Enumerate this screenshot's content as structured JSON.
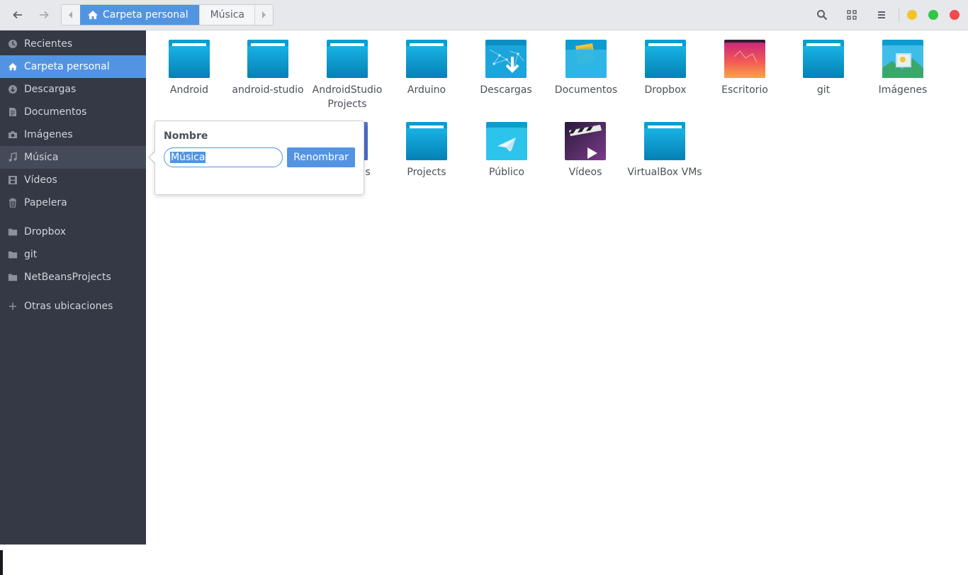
{
  "header": {
    "back_icon": "arrow-left-icon",
    "forward_icon": "arrow-right-icon",
    "path": {
      "current": "Carpeta personal",
      "next": "Música"
    },
    "actions": [
      "search-icon",
      "view-grid-icon",
      "menu-icon"
    ],
    "window_controls": {
      "minimize_color": "#f5c22a",
      "maximize_color": "#33c748",
      "close_color": "#f24a4e"
    }
  },
  "sidebar": {
    "items": [
      {
        "label": "Recientes",
        "icon": "clock-icon"
      },
      {
        "label": "Carpeta personal",
        "icon": "home-icon",
        "selected": true
      },
      {
        "label": "Descargas",
        "icon": "download-icon"
      },
      {
        "label": "Documentos",
        "icon": "document-icon"
      },
      {
        "label": "Imágenes",
        "icon": "camera-icon"
      },
      {
        "label": "Música",
        "icon": "music-icon",
        "hovered": true
      },
      {
        "label": "Vídeos",
        "icon": "film-icon"
      },
      {
        "label": "Papelera",
        "icon": "trash-icon"
      },
      {
        "label": "Dropbox",
        "icon": "folder-icon"
      },
      {
        "label": "git",
        "icon": "folder-icon"
      },
      {
        "label": "NetBeansProjects",
        "icon": "folder-icon"
      },
      {
        "label": "Otras ubicaciones",
        "icon": "plus-icon"
      }
    ]
  },
  "files": [
    {
      "name": "Android"
    },
    {
      "name": "android-studio"
    },
    {
      "name": "AndroidStudio Projects"
    },
    {
      "name": "Arduino"
    },
    {
      "name": "Descargas"
    },
    {
      "name": "Documentos"
    },
    {
      "name": "Dropbox"
    },
    {
      "name": "Escritorio"
    },
    {
      "name": "git"
    },
    {
      "name": "Imágenes"
    },
    {
      "name": "s"
    },
    {
      "name": "Projects"
    },
    {
      "name": "Público"
    },
    {
      "name": "Vídeos"
    },
    {
      "name": "VirtualBox VMs"
    }
  ],
  "rename_popover": {
    "title": "Nombre",
    "value": "Música",
    "button": "Renombrar"
  },
  "colors": {
    "accent": "#5294e2",
    "sidebar_bg": "#353945",
    "folder": "#0d9cd0"
  }
}
